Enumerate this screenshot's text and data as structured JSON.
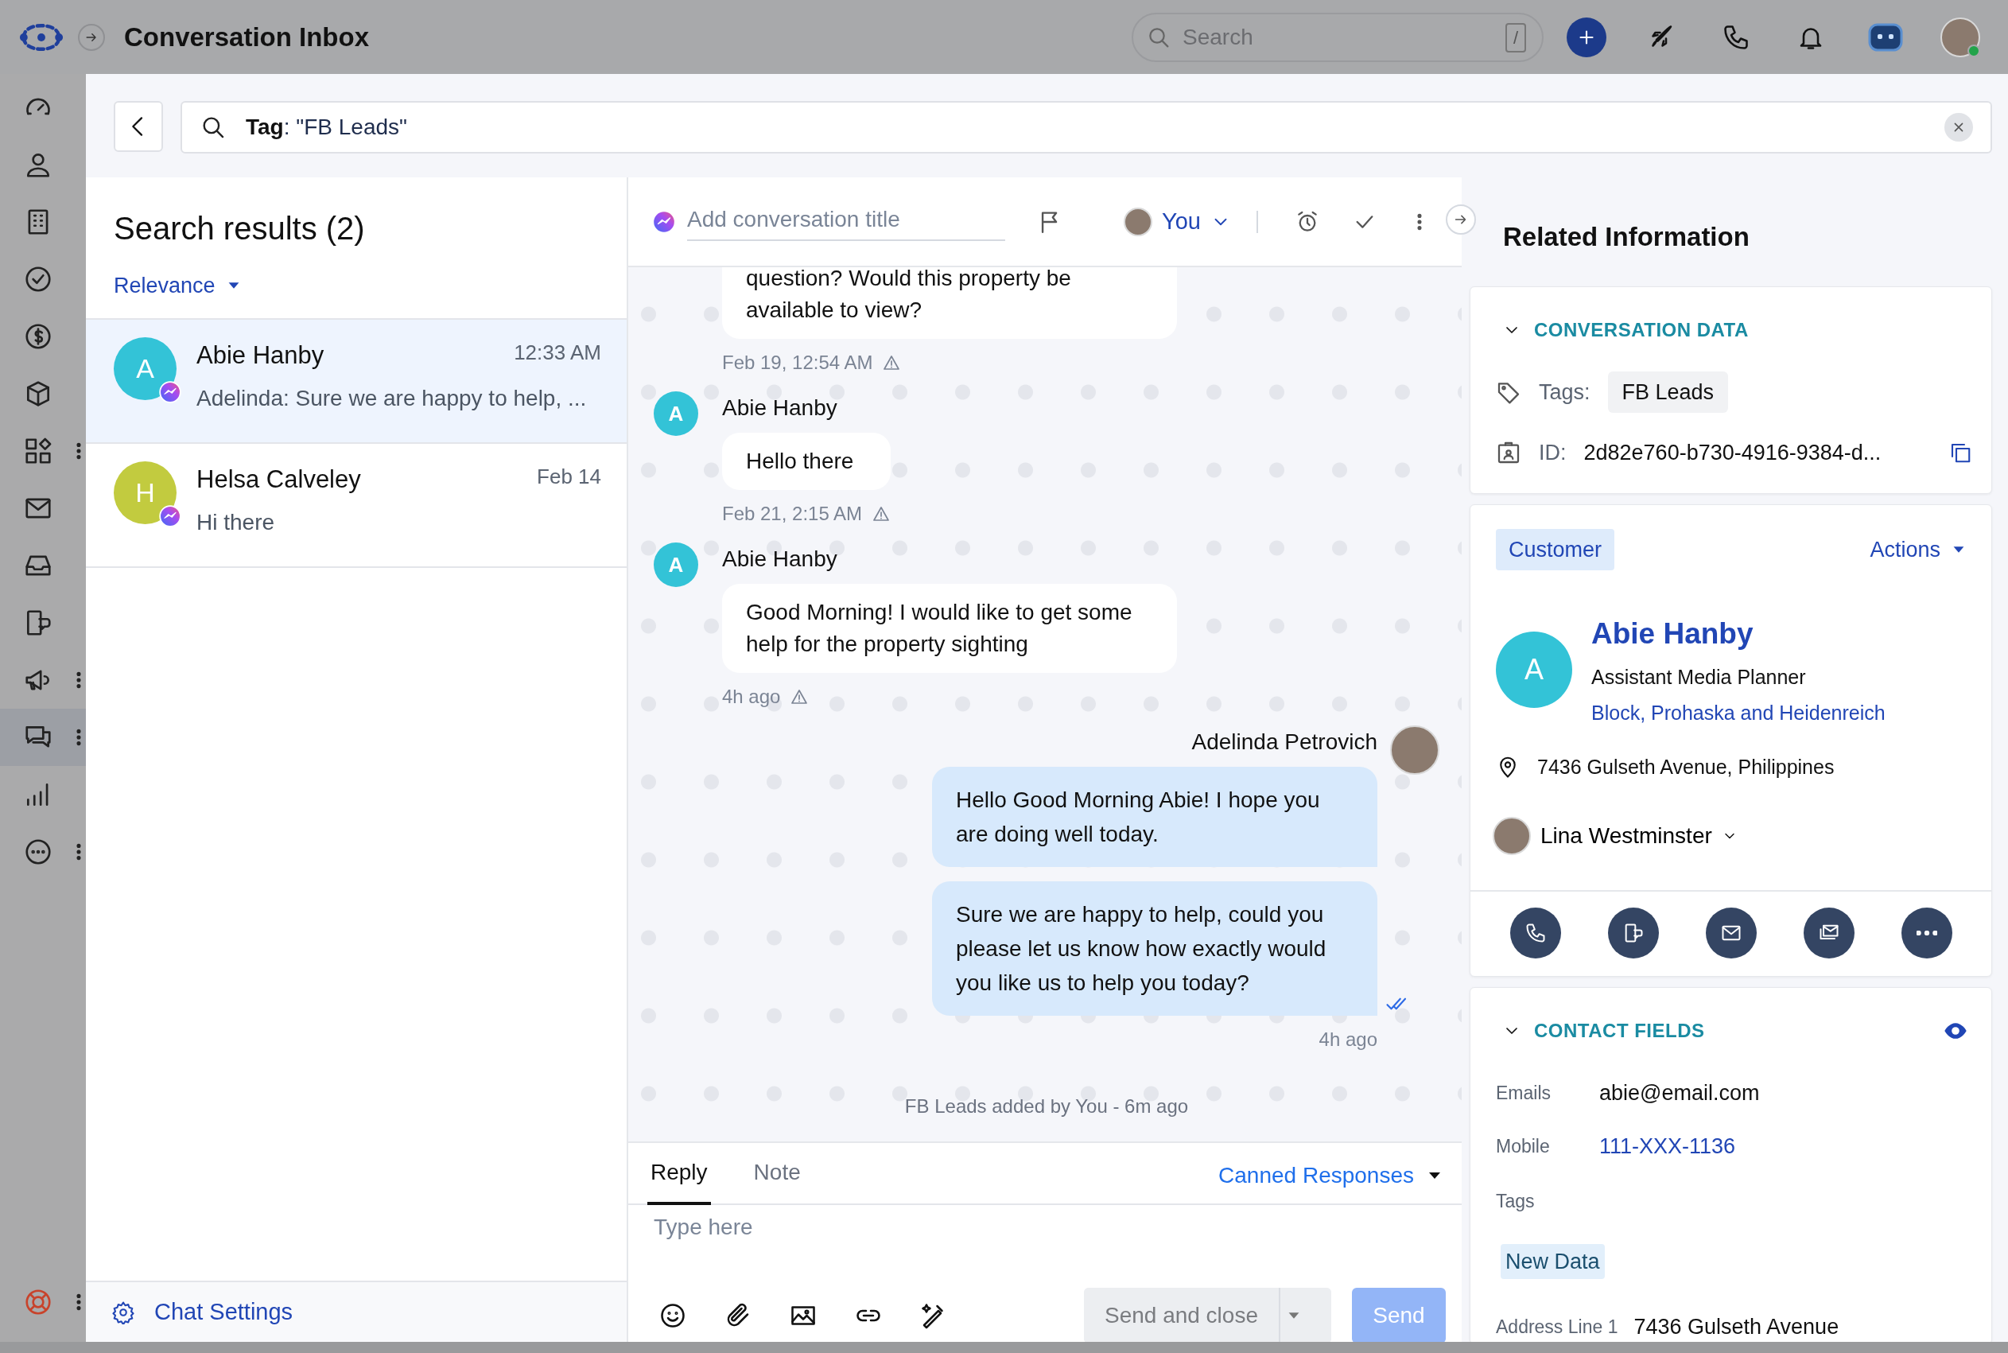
{
  "app": {
    "title": "Conversation Inbox"
  },
  "header": {
    "search": {
      "placeholder": "Search",
      "shortcut": "/"
    }
  },
  "sidebar": {
    "items": [
      {
        "selected": false,
        "menu": false
      },
      {
        "selected": false,
        "menu": false
      },
      {
        "selected": false,
        "menu": false
      },
      {
        "selected": false,
        "menu": false
      },
      {
        "selected": false,
        "menu": false
      },
      {
        "selected": false,
        "menu": false
      },
      {
        "selected": false,
        "menu": true
      },
      {
        "selected": false,
        "menu": false
      },
      {
        "selected": false,
        "menu": false
      },
      {
        "selected": false,
        "menu": false
      },
      {
        "selected": false,
        "menu": true
      },
      {
        "selected": true,
        "menu": true
      },
      {
        "selected": false,
        "menu": false
      },
      {
        "selected": false,
        "menu": true
      }
    ],
    "help": {
      "menu": true
    }
  },
  "filter": {
    "query": "**Tag**: \"FB Leads\""
  },
  "results": {
    "title": "Search results (2)",
    "sort": "Relevance",
    "items": [
      {
        "initial": "A",
        "color": "#33c3d7",
        "name": "Abie Hanby",
        "time": "12:33 AM",
        "preview": "Adelinda: Sure we are happy to help, ...",
        "selected": true
      },
      {
        "initial": "H",
        "color": "#c2cb3f",
        "name": "Helsa Calveley",
        "time": "Feb 14",
        "preview": "Hi there",
        "selected": false
      }
    ],
    "settings": "Chat Settings"
  },
  "conversation": {
    "title_placeholder": "Add conversation title",
    "assignee": "You",
    "groups": [
      {
        "kind": "incoming",
        "bubbles": [
          {
            "text": "question? Would this property be available to view?",
            "partial": true
          }
        ],
        "time": "Feb 19, 12:54 AM",
        "warning": true
      },
      {
        "kind": "incoming",
        "initial": "A",
        "sender": "Abie Hanby",
        "bubbles": [
          {
            "text": "Hello there",
            "partial": false
          }
        ],
        "time": "Feb 21, 2:15 AM",
        "warning": true
      },
      {
        "kind": "incoming",
        "initial": "A",
        "sender": "Abie Hanby",
        "bubbles": [
          {
            "text": "Good Morning! I would like to get some help for the property sighting",
            "partial": false
          }
        ],
        "time": "4h ago",
        "warning": true
      },
      {
        "kind": "outgoing",
        "sender": "Adelinda Petrovich",
        "bubbles": [
          {
            "text": "Hello Good Morning Abie! I hope you are doing well today.",
            "partial": false
          },
          {
            "text": "Sure we are happy to help, could you please let us know how exactly would you like us to help you today?",
            "partial": false
          }
        ],
        "time": "4h ago",
        "read": true
      }
    ],
    "event": "FB Leads added by You - 6m ago",
    "composer": {
      "tabs": [
        {
          "label": "Reply",
          "selected": true
        },
        {
          "label": "Note",
          "selected": false
        }
      ],
      "canned": "Canned Responses",
      "placeholder": "Type here",
      "send_close": "Send and close",
      "send": "Send",
      "send_disabled": true
    }
  },
  "related": {
    "title": "Related Information",
    "conversation_data": {
      "title": "CONVERSATION DATA",
      "expanded": true,
      "tags_label": "Tags:",
      "tags": [
        "FB Leads"
      ],
      "id_label": "ID:",
      "id": "2d82e760-b730-4916-9384-d..."
    },
    "contact": {
      "type": "Customer",
      "actions": "Actions",
      "initial": "A",
      "name": "Abie Hanby",
      "job": "Assistant Media Planner",
      "company": "Block, Prohaska and Heidenreich",
      "address": "7436 Gulseth Avenue, Philippines",
      "owner": "Lina Westminster"
    },
    "contact_fields": {
      "title": "CONTACT FIELDS",
      "expanded": true,
      "fields": [
        {
          "kind": "text",
          "label": "Emails",
          "value": "abie@email.com"
        },
        {
          "kind": "link",
          "label": "Mobile",
          "value": "111-XXX-1136"
        },
        {
          "kind": "tags",
          "label": "Tags",
          "tags": [
            "New Data"
          ]
        },
        {
          "kind": "text",
          "label": "Address Line 1",
          "value": "7436 Gulseth Avenue"
        }
      ]
    }
  }
}
